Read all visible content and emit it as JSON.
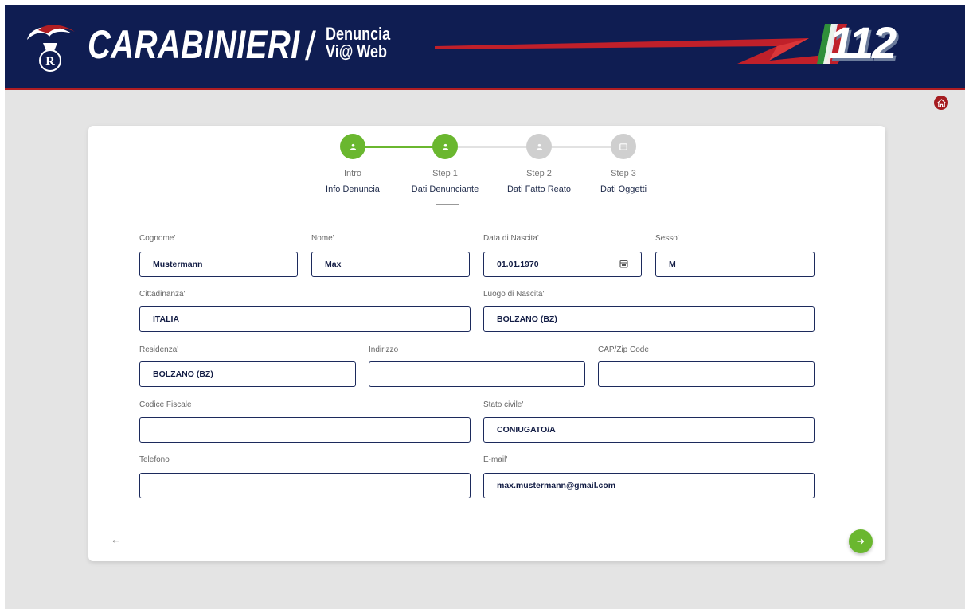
{
  "header": {
    "brand": "CARABINIERI",
    "divider": "/",
    "product_line1": "Denuncia",
    "product_line2": "Vi@ Web",
    "emergency_number": "112",
    "emblem_letter": "R"
  },
  "stepper": {
    "steps": [
      {
        "title": "Intro",
        "subtitle": "Info Denuncia",
        "status": "completed"
      },
      {
        "title": "Step 1",
        "subtitle": "Dati Denunciante",
        "status": "current"
      },
      {
        "title": "Step 2",
        "subtitle": "Dati Fatto Reato",
        "status": "pending"
      },
      {
        "title": "Step 3",
        "subtitle": "Dati Oggetti",
        "status": "pending"
      }
    ]
  },
  "form": {
    "cognome": {
      "label": "Cognome",
      "value": "Mustermann"
    },
    "nome": {
      "label": "Nome",
      "value": "Max"
    },
    "data_nascita": {
      "label": "Data di Nascita",
      "value": "01.01.1970"
    },
    "sesso": {
      "label": "Sesso",
      "value": "M"
    },
    "cittadinanza": {
      "label": "Cittadinanza",
      "value": "ITALIA"
    },
    "luogo_nascita": {
      "label": "Luogo di Nascita",
      "value": "BOLZANO (BZ)"
    },
    "residenza": {
      "label": "Residenza",
      "value": "BOLZANO (BZ)"
    },
    "indirizzo": {
      "label": "Indirizzo",
      "value": ""
    },
    "cap": {
      "label": "CAP/Zip Code",
      "value": ""
    },
    "codice_fiscale": {
      "label": "Codice Fiscale",
      "value": ""
    },
    "stato_civile": {
      "label": "Stato civile",
      "value": "CONIUGATO/A"
    },
    "telefono": {
      "label": "Telefono",
      "value": ""
    },
    "email": {
      "label": "E-mail",
      "value": "max.mustermann@gmail.com"
    },
    "required_marker": "'"
  },
  "nav": {
    "back_label": "←",
    "next_icon": "arrow-right-icon",
    "home_icon": "home-icon"
  },
  "colors": {
    "header_bg": "#0f1d52",
    "accent_red": "#b01e23",
    "step_active": "#6ab72f",
    "step_pending": "#cfcfcf",
    "field_border": "#1c2a5c"
  }
}
